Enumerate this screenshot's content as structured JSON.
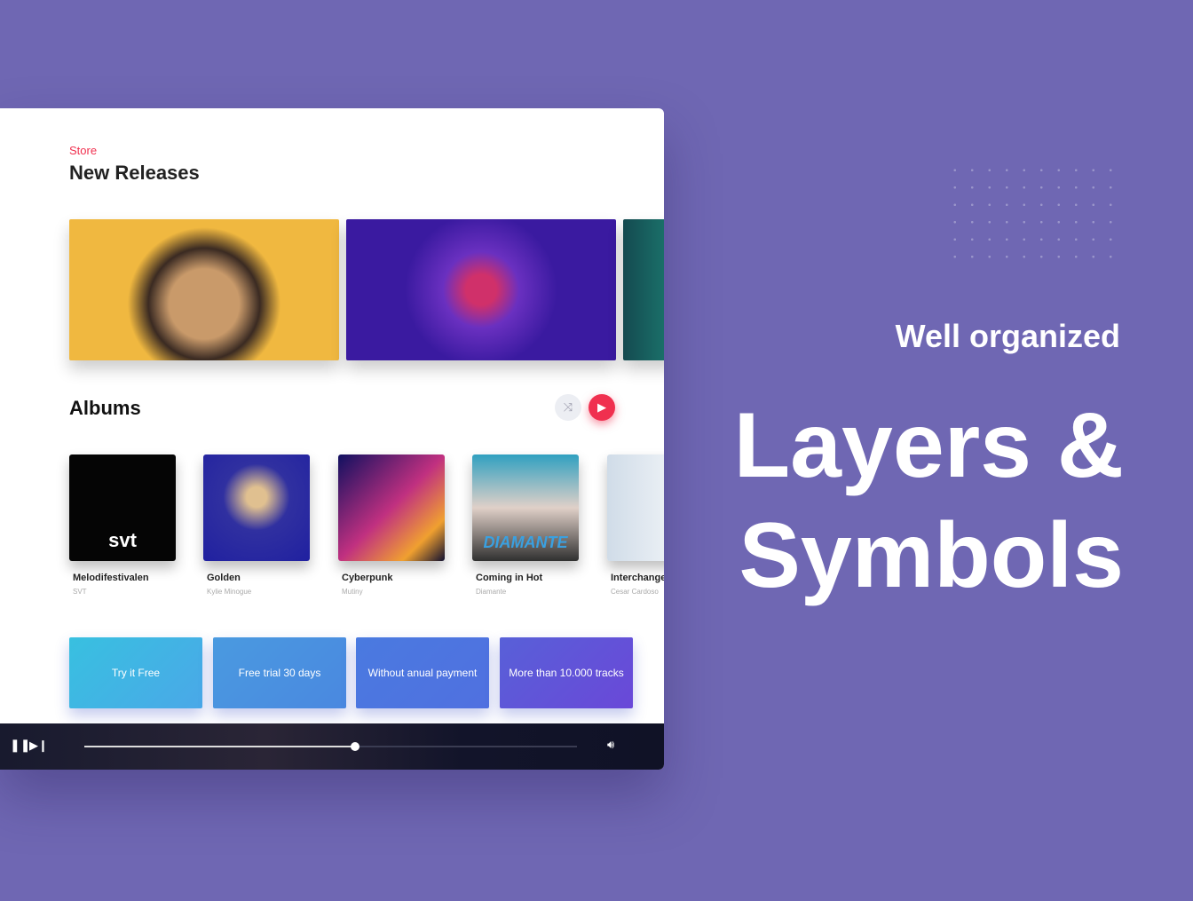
{
  "store": {
    "label": "Store",
    "title": "New Releases"
  },
  "albums": {
    "title": "Albums",
    "items": [
      {
        "name": "Melodifestivalen",
        "artist": "SVT",
        "art_text": "svt"
      },
      {
        "name": "Golden",
        "artist": "Kylie Minogue"
      },
      {
        "name": "Cyberpunk",
        "artist": "Mutiny"
      },
      {
        "name": "Coming in Hot",
        "artist": "Diamante",
        "art_text": "DIAMANTE"
      },
      {
        "name": "Interchange",
        "artist": "Cesar Cardoso"
      }
    ]
  },
  "promos": [
    "Try it Free",
    "Free trial 30 days",
    "Without anual payment",
    "More than 10.000 tracks"
  ],
  "player": {
    "progress": 0.55
  },
  "hero": {
    "subtitle": "Well organized",
    "line1": "Layers &",
    "line2": "Symbols"
  },
  "colors": {
    "background": "#6f67b3",
    "accent": "#f0304f"
  }
}
